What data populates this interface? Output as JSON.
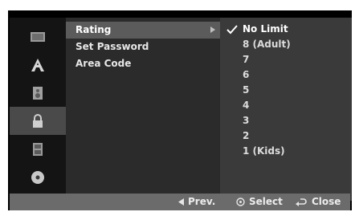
{
  "left_menu": [
    {
      "icon": "film-reel-icon",
      "active": false
    },
    {
      "icon": "language-a-icon",
      "active": false
    },
    {
      "icon": "speaker-icon",
      "active": false
    },
    {
      "icon": "lock-icon",
      "active": true
    },
    {
      "icon": "film-strip-icon",
      "active": false
    },
    {
      "icon": "disc-icon",
      "active": false
    }
  ],
  "submenu": {
    "items": [
      {
        "label": "Rating",
        "selected": true
      },
      {
        "label": "Set Password",
        "selected": false
      },
      {
        "label": "Area Code",
        "selected": false
      }
    ]
  },
  "options": {
    "items": [
      {
        "label": "No Limit",
        "checked": true
      },
      {
        "label": "8 (Adult)",
        "checked": false
      },
      {
        "label": "7",
        "checked": false
      },
      {
        "label": "6",
        "checked": false
      },
      {
        "label": "5",
        "checked": false
      },
      {
        "label": "4",
        "checked": false
      },
      {
        "label": "3",
        "checked": false
      },
      {
        "label": "2",
        "checked": false
      },
      {
        "label": "1 (Kids)",
        "checked": false
      }
    ]
  },
  "footer": {
    "prev_label": "Prev.",
    "select_label": "Select",
    "close_label": "Close"
  },
  "colors": {
    "screen_bg": "#000000",
    "icon_active_bg": "#4a4a4a",
    "submenu_selected_bg": "#5b5b5b",
    "options_bg": "#3a3a3a",
    "footer_bg": "#6b6b6b"
  }
}
